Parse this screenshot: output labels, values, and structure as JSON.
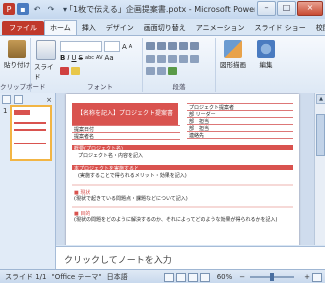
{
  "window": {
    "title": "「1枚で伝える」企画提案書.potx - Microsoft PowerPoint",
    "minimize": "–",
    "maximize": "□",
    "close": "×"
  },
  "qat": {
    "undo": "↶",
    "redo": "↷",
    "more": "▾"
  },
  "tabs": [
    {
      "label": "ファイル"
    },
    {
      "label": "ホーム"
    },
    {
      "label": "挿入"
    },
    {
      "label": "デザイン"
    },
    {
      "label": "画面切り替え"
    },
    {
      "label": "アニメーション"
    },
    {
      "label": "スライド ショー"
    },
    {
      "label": "校閲"
    },
    {
      "label": "表示"
    }
  ],
  "ribbon": {
    "paste_label": "貼り付け",
    "slide_label": "スライド",
    "clipboard_group": "クリップボード",
    "font_group": "フォント",
    "paragraph_group": "段落",
    "shapes_label": "図形描画",
    "edit_label": "編集",
    "font_size_up": "A",
    "font_size_down": "A",
    "font_aa": "Aa",
    "bold": "B",
    "italic": "I",
    "underline": "U",
    "strike": "S",
    "abc": "abc",
    "av": "AV"
  },
  "pane": {
    "close": "×",
    "slide_number": "1"
  },
  "slide": {
    "title": "【名称を記入】プロジェクト提案書",
    "rows_right": [
      "プロジェクト提案者",
      "部 リーダー",
      "部　担当",
      "部　担当",
      "連絡先"
    ],
    "rows_left": [
      "提案日付",
      "提案者名"
    ],
    "section1": "概要(プロジェクト名)",
    "section1_text": "プロジェクト名・内容を記入",
    "section2": "本プロジェクトを実施すると",
    "section2_text": "(実施することで得られるメリット・効果を記入)",
    "section3_head": "■ 現状",
    "section3_text": "(現状で起きている問題点・課題などについて記入)",
    "section4_head": "■ 目的",
    "section4_text": "(現状の問題をどのように解決するのか、それによってどのような効果が得られるかを記入)"
  },
  "notes": {
    "placeholder": "クリックしてノートを入力"
  },
  "status": {
    "slide": "スライド 1/1",
    "theme": "\"Office テーマ\"",
    "lang": "日本語",
    "zoom": "60%",
    "minus": "−",
    "plus": "+"
  }
}
